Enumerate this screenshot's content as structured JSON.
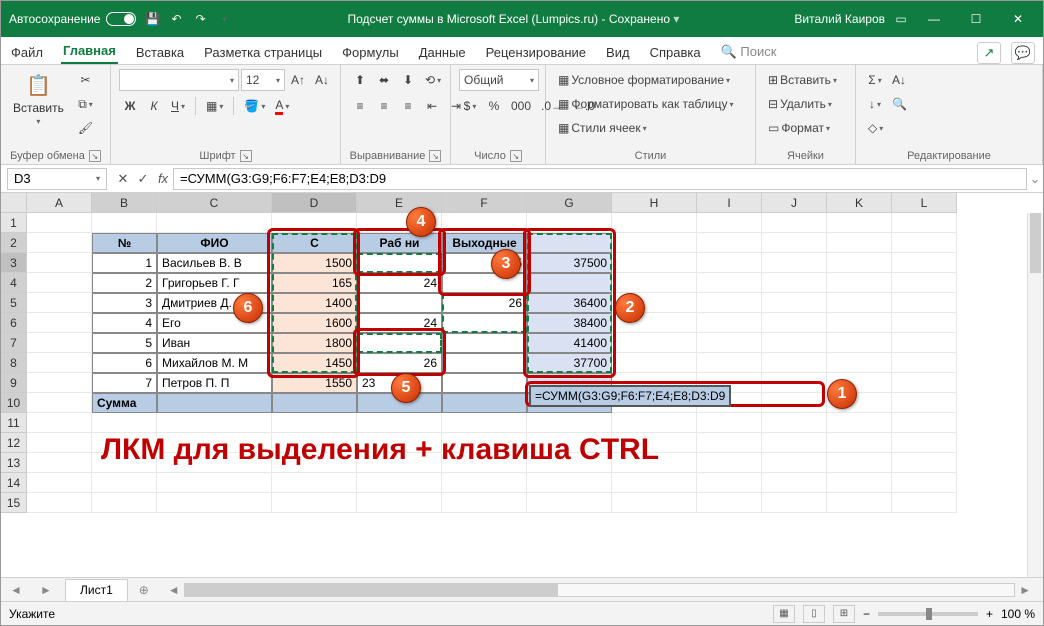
{
  "titlebar": {
    "autosave": "Автосохранение",
    "title": "Подсчет суммы в Microsoft Excel (Lumpics.ru)",
    "saved": "Сохранено",
    "user": "Виталий Каиров"
  },
  "tabs": {
    "file": "Файл",
    "home": "Главная",
    "insert": "Вставка",
    "layout": "Разметка страницы",
    "formulas": "Формулы",
    "data": "Данные",
    "review": "Рецензирование",
    "view": "Вид",
    "help": "Справка",
    "search": "Поиск"
  },
  "ribbon": {
    "paste": "Вставить",
    "clipboard": "Буфер обмена",
    "font": "Шрифт",
    "fontsize": "12",
    "align": "Выравнивание",
    "numfmt": "Общий",
    "number": "Число",
    "condfmt": "Условное форматирование",
    "tablefmt": "Форматировать как таблицу",
    "cellstyles": "Стили ячеек",
    "styles": "Стили",
    "insertc": "Вставить",
    "deletec": "Удалить",
    "formatc": "Формат",
    "cells": "Ячейки",
    "editing": "Редактирование"
  },
  "fbar": {
    "ref": "D3",
    "fx": "fx",
    "formula": "=СУММ(G3:G9;F6:F7;E4;E8;D3:D9"
  },
  "cols": [
    "A",
    "B",
    "C",
    "D",
    "E",
    "F",
    "G",
    "H",
    "I",
    "J",
    "K",
    "L"
  ],
  "table": {
    "h1": "№",
    "h2": "ФИО",
    "h3": "С",
    "h4": "Раб",
    "h4b": "ни",
    "h5": "Выходные",
    "rows": [
      {
        "n": "1",
        "fio": "Васильев В. В",
        "d": "1500",
        "e": "",
        "f": "",
        "g": "37500"
      },
      {
        "n": "2",
        "fio": "Григорьев Г. Г",
        "d": "165",
        "e": "24",
        "f": "",
        "g": ""
      },
      {
        "n": "3",
        "fio": "Дмитриев Д. Д",
        "d": "1400",
        "e": "",
        "f": "26",
        "g": "36400"
      },
      {
        "n": "4",
        "fio": "Его",
        "d": "1600",
        "e": "24",
        "f": "",
        "g": "38400"
      },
      {
        "n": "5",
        "fio": "Иван",
        "d": "1800",
        "e": "",
        "f": "",
        "g": "41400"
      },
      {
        "n": "6",
        "fio": "Михайлов М. М",
        "d": "1450",
        "e": "26",
        "f": "",
        "g": "37700"
      },
      {
        "n": "7",
        "fio": "Петров П. П",
        "d": "1550",
        "e": "23",
        "f": "",
        "g": ""
      }
    ],
    "sumlbl": "Сумма",
    "f3": "25"
  },
  "formula_cell": "=СУММ(G3:G9;F6:F7;E4;E8;D3:D9",
  "overlay_text": "ЛКМ для выделения + клавиша CTRL",
  "sheet": "Лист1",
  "status": "Укажите",
  "zoom": "100 %"
}
